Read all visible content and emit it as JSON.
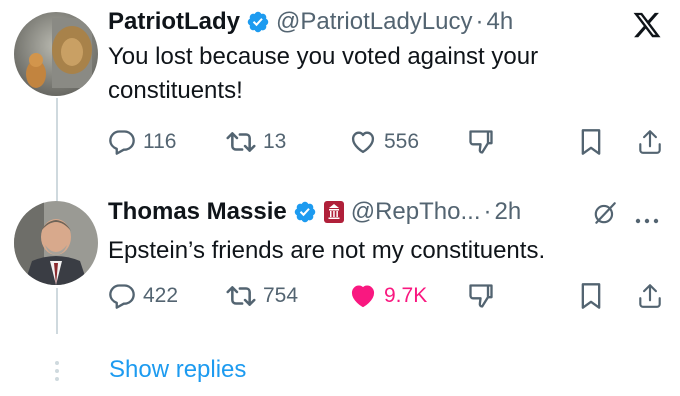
{
  "tweet1": {
    "name": "PatriotLady",
    "handle": "@PatriotLadyLucy",
    "time": "4h",
    "text": "You lost because you voted against your constituents!",
    "replies": "116",
    "reposts": "13",
    "likes": "556"
  },
  "tweet2": {
    "name": "Thomas Massie",
    "handle": "@RepTho...",
    "time": "2h",
    "text": "Epstein’s friends are not my constituents.",
    "replies": "422",
    "reposts": "754",
    "likes": "9.7K"
  },
  "show_replies": "Show replies",
  "colors": {
    "verified": "#1d9bf0",
    "like_active": "#f91880",
    "secondary": "#536471",
    "link": "#1d9bf0",
    "gov_badge": "#b0203a"
  },
  "icons": [
    "x-logo-icon",
    "verified-badge-icon",
    "government-badge-icon",
    "reply-icon",
    "repost-icon",
    "like-icon",
    "dislike-icon",
    "bookmark-icon",
    "share-icon",
    "grok-icon",
    "more-icon"
  ]
}
